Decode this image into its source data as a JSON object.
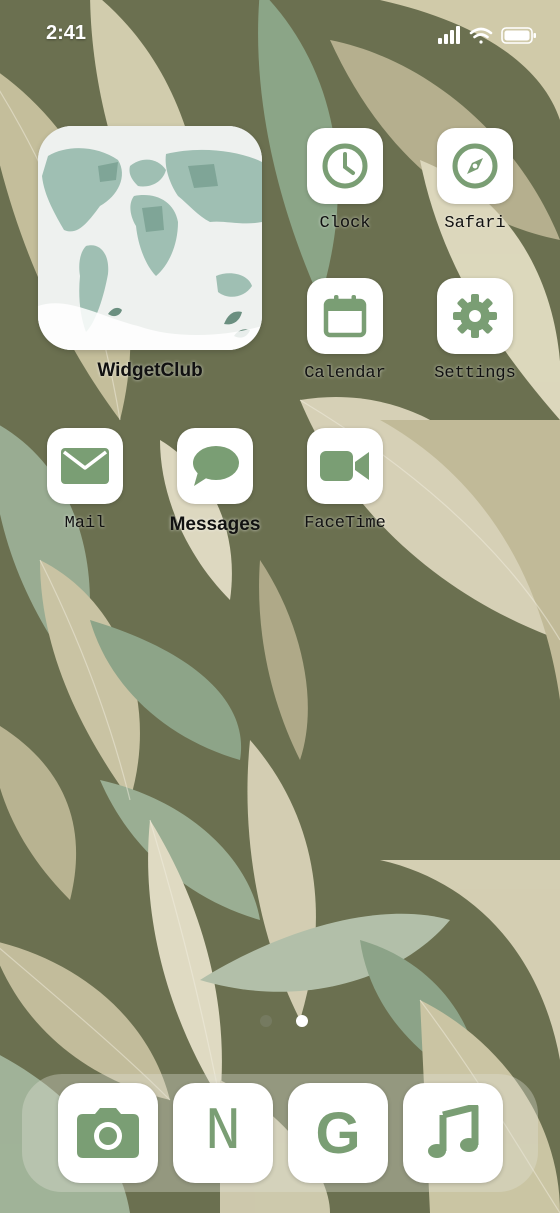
{
  "status_bar": {
    "time": "2:41",
    "icons": [
      "signal-icon",
      "wifi-icon",
      "battery-icon"
    ]
  },
  "widget": {
    "label": "WidgetClub",
    "image": "world-map-image"
  },
  "apps": [
    {
      "label": "Clock",
      "icon": "clock-icon"
    },
    {
      "label": "Safari",
      "icon": "compass-icon"
    },
    {
      "label": "Calendar",
      "icon": "calendar-icon"
    },
    {
      "label": "Settings",
      "icon": "gear-icon"
    },
    {
      "label": "Mail",
      "icon": "envelope-icon"
    },
    {
      "label": "Messages",
      "icon": "speech-bubble-icon"
    },
    {
      "label": "FaceTime",
      "icon": "video-camera-icon"
    }
  ],
  "dock": [
    {
      "icon": "camera-icon"
    },
    {
      "letter": "N",
      "icon": "letter-n-icon"
    },
    {
      "letter": "G",
      "icon": "letter-g-icon"
    },
    {
      "icon": "music-note-icon"
    }
  ],
  "page_indicator": {
    "count": 2,
    "current": 2
  },
  "colors": {
    "icon_green": "#7a9e74",
    "tile_white": "#ffffff",
    "wallpaper_base": "#6b7050"
  }
}
